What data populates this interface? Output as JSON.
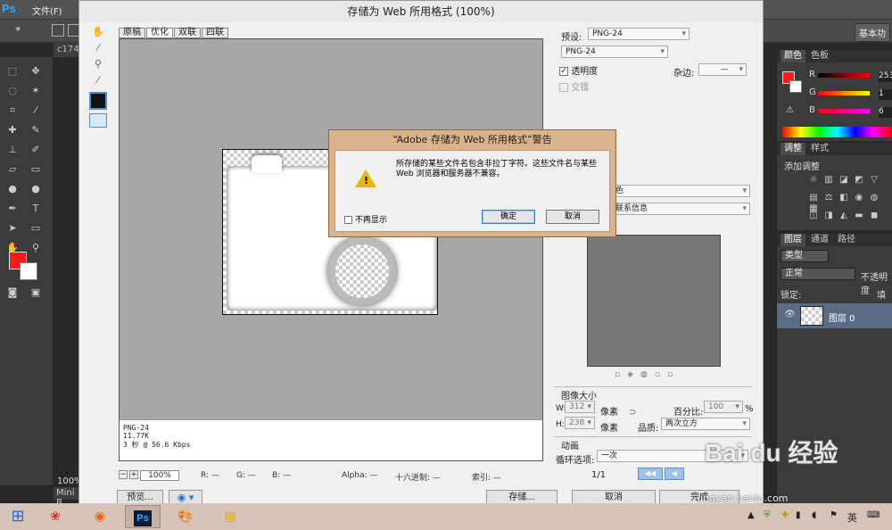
{
  "ps": {
    "menu": "文件(F)",
    "workspace": "基本功",
    "tab_name": "c174",
    "zoom": "100%",
    "bottom_tab": "Mini B"
  },
  "panels": {
    "color": {
      "tabs": [
        "颜色",
        "色板"
      ],
      "r": "253",
      "g": "1",
      "b": "6"
    },
    "adjust": {
      "tabs": [
        "调整",
        "样式"
      ],
      "title": "添加调整"
    },
    "layers": {
      "tabs": [
        "图层",
        "通道",
        "路径"
      ],
      "kind": "类型",
      "blend": "正常",
      "opacity_label": "不透明度",
      "lock_label": "锁定:",
      "fill_label": "填充",
      "layer_name": "图层 0"
    }
  },
  "dialog": {
    "title": "存储为 Web 所用格式 (100%)",
    "tabs": [
      "原稿",
      "优化",
      "双联",
      "四联"
    ],
    "info": {
      "format": "PNG-24",
      "size": "11.77K",
      "speed": "3 秒 @ 56.6 Kbps"
    },
    "status": {
      "zoom": "100%",
      "r": "R: —",
      "g": "G: —",
      "b": "B: —",
      "alpha": "Alpha: —",
      "hex": "十六进制: —",
      "index": "索引: —"
    },
    "bottom": {
      "preview": "预览...",
      "save": "存储...",
      "cancel": "取消",
      "done": "完成"
    },
    "settings": {
      "preset_label": "预设:",
      "preset": "PNG-24",
      "format": "PNG-24",
      "transparency": "透明度",
      "interlaced": "交错",
      "matte_label": "杂边:",
      "matte": "—",
      "convert": "色",
      "metadata": "联系信息"
    },
    "image_size": {
      "title": "图像大小",
      "w_label": "W:",
      "w": "312",
      "h_label": "H:",
      "h": "238",
      "unit": "像素",
      "percent_label": "百分比:",
      "percent": "100",
      "percent_unit": "%",
      "quality_label": "品质:",
      "quality": "两次立方"
    },
    "animation": {
      "title": "动画",
      "loop_label": "循环选项:",
      "loop": "一次",
      "frame": "1/1"
    }
  },
  "alert": {
    "title": "“Adobe 存储为 Web 所用格式”警告",
    "message": "所存储的某些文件名包含非拉丁字符。这些文件名与某些 Web 浏览器和服务器不兼容。",
    "dont_show": "不再显示",
    "ok": "确定",
    "cancel": "取消"
  },
  "taskbar": {
    "lang": "英",
    "watermark": "jingyan.baidu.com",
    "brand": "Bai du 经验"
  }
}
